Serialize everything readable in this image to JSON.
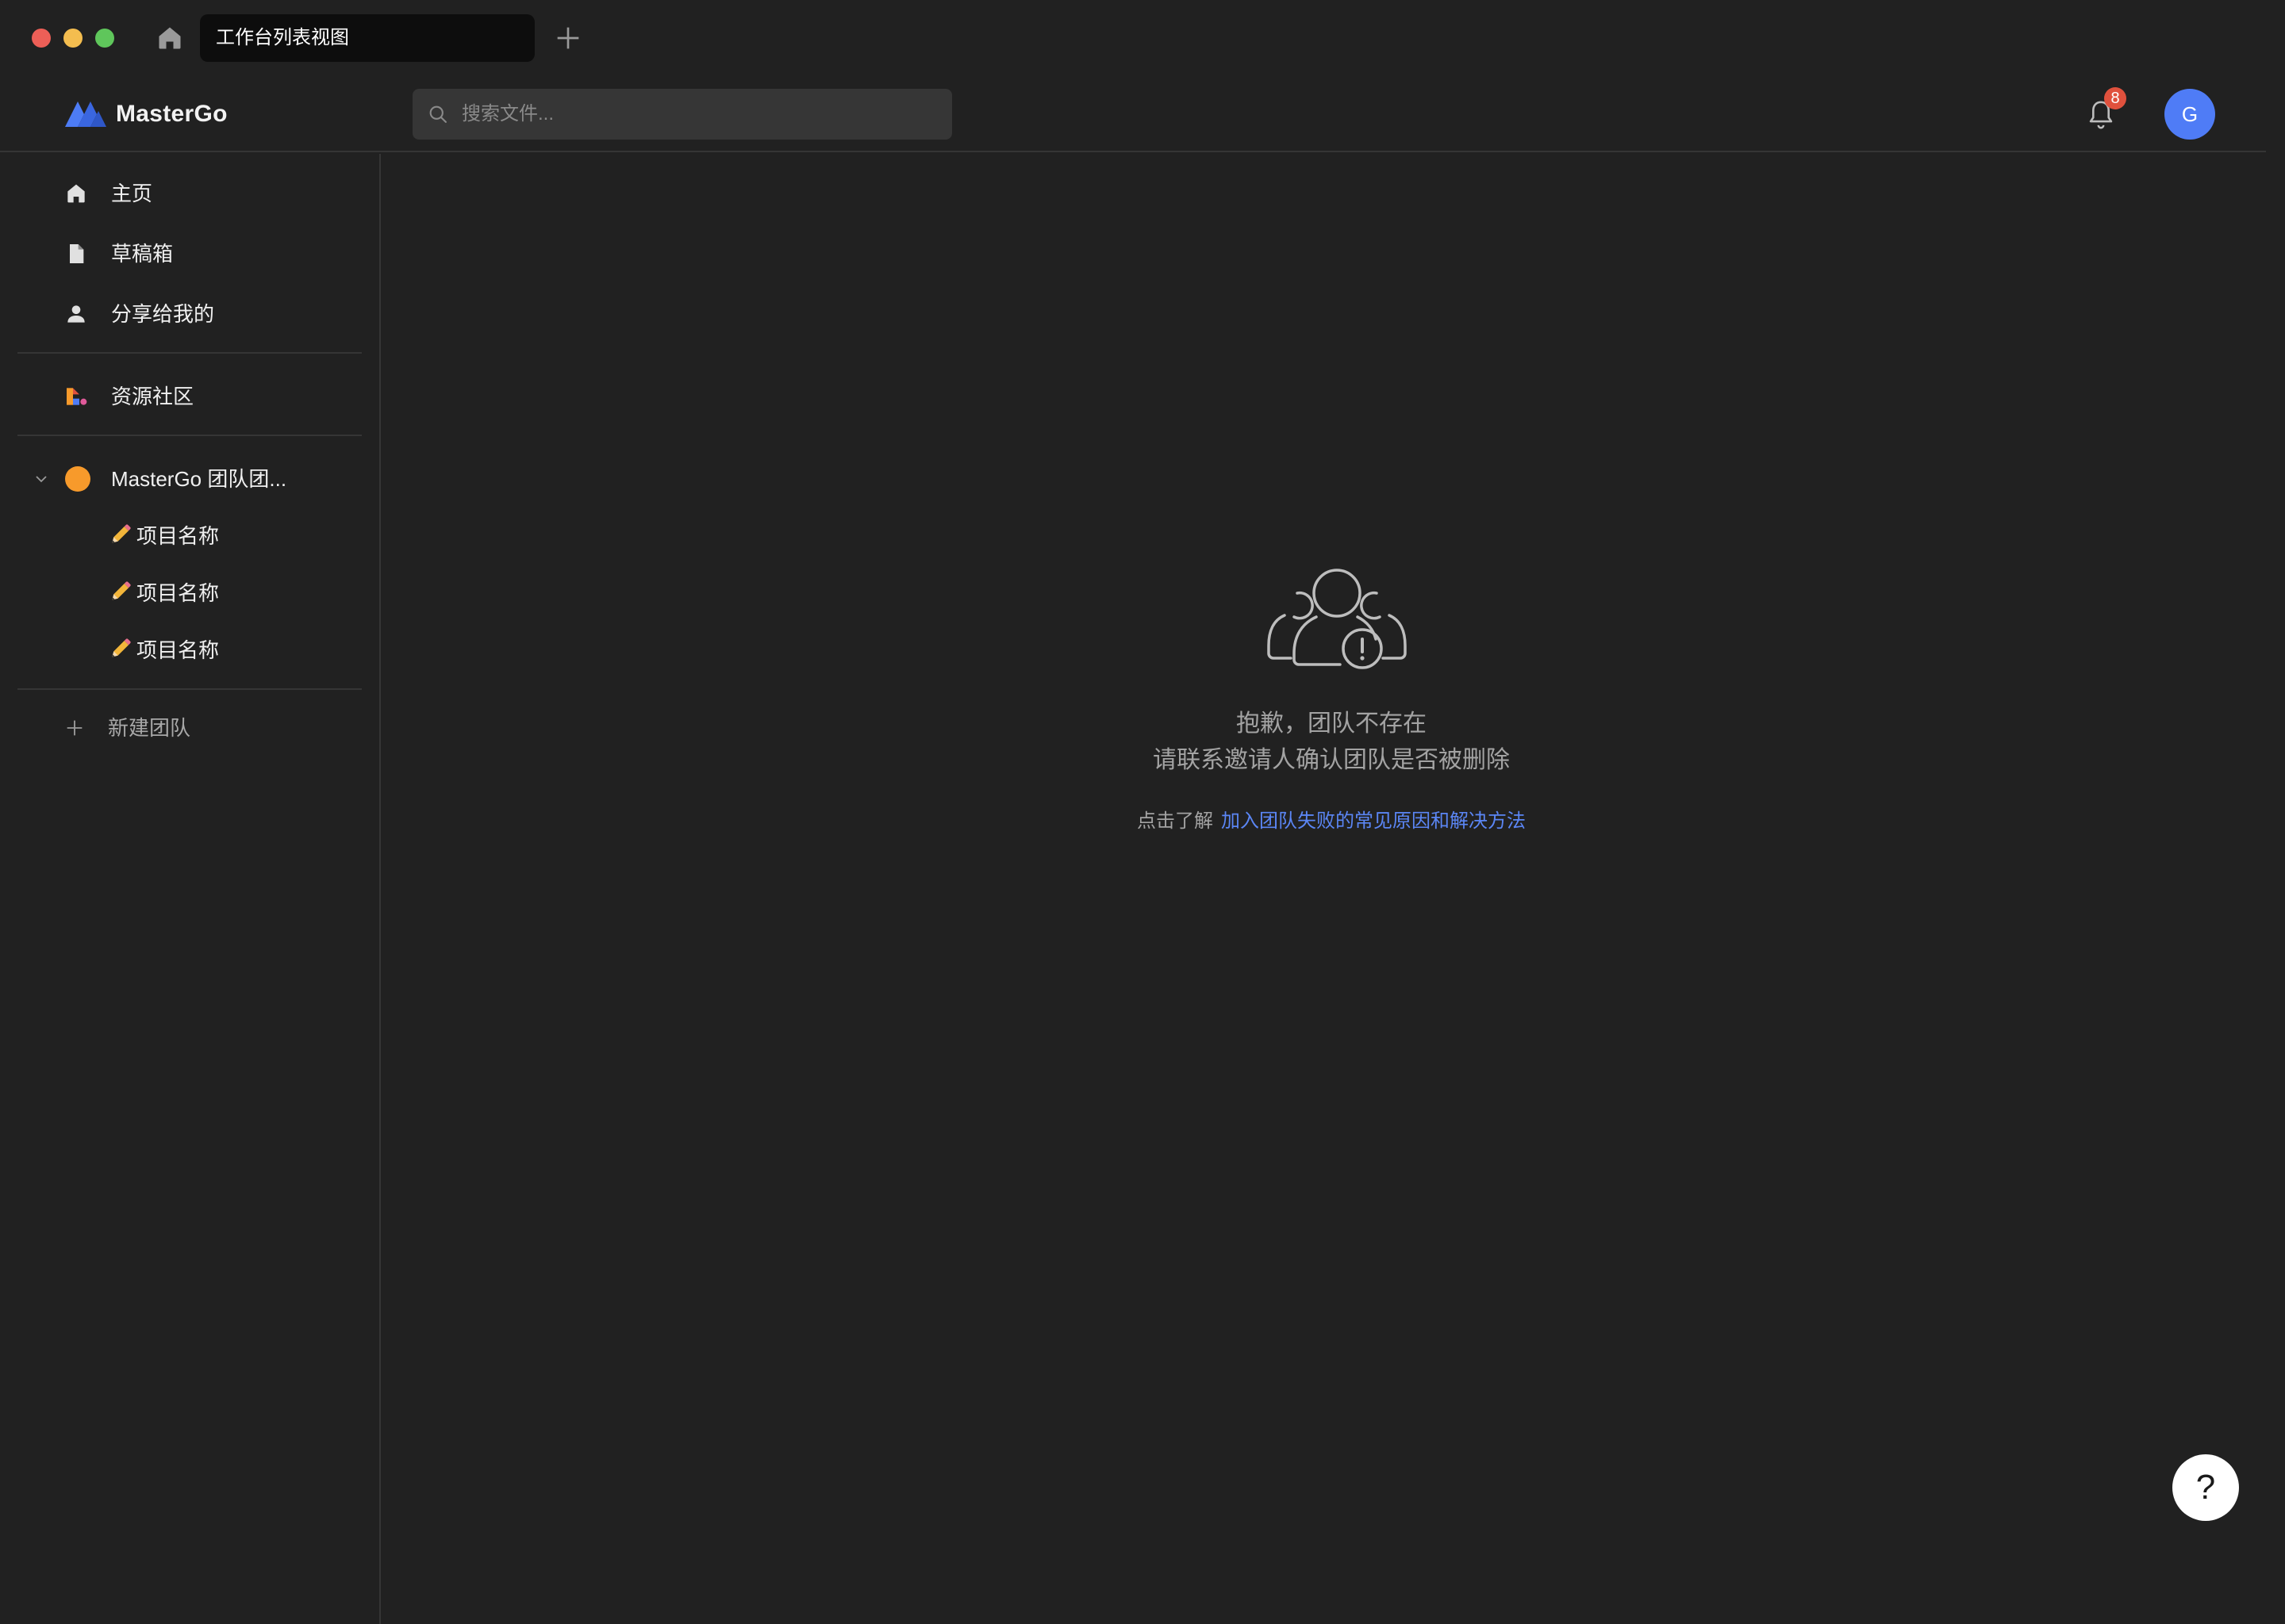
{
  "titlebar": {
    "active_tab": "工作台列表视图"
  },
  "header": {
    "brand": "MasterGo",
    "search_placeholder": "搜索文件...",
    "notification_count": "8",
    "avatar_initial": "G",
    "accent_color": "#4f7cf6"
  },
  "sidebar": {
    "nav": [
      {
        "label": "主页",
        "icon": "home-icon"
      },
      {
        "label": "草稿箱",
        "icon": "file-icon"
      },
      {
        "label": "分享给我的",
        "icon": "user-icon"
      }
    ],
    "community": {
      "label": "资源社区",
      "icon": "community-icon"
    },
    "team": {
      "label": "MasterGo 团队团...",
      "color": "#f79a2b"
    },
    "projects": [
      {
        "label": "项目名称"
      },
      {
        "label": "项目名称"
      },
      {
        "label": "项目名称"
      }
    ],
    "new_team_label": "新建团队"
  },
  "main": {
    "empty_title_line1": "抱歉，团队不存在",
    "empty_title_line2": "请联系邀请人确认团队是否被删除",
    "help_prefix": "点击了解",
    "help_link": "加入团队失败的常见原因和解决方法",
    "link_color": "#5b86f5"
  },
  "help_button_label": "?"
}
